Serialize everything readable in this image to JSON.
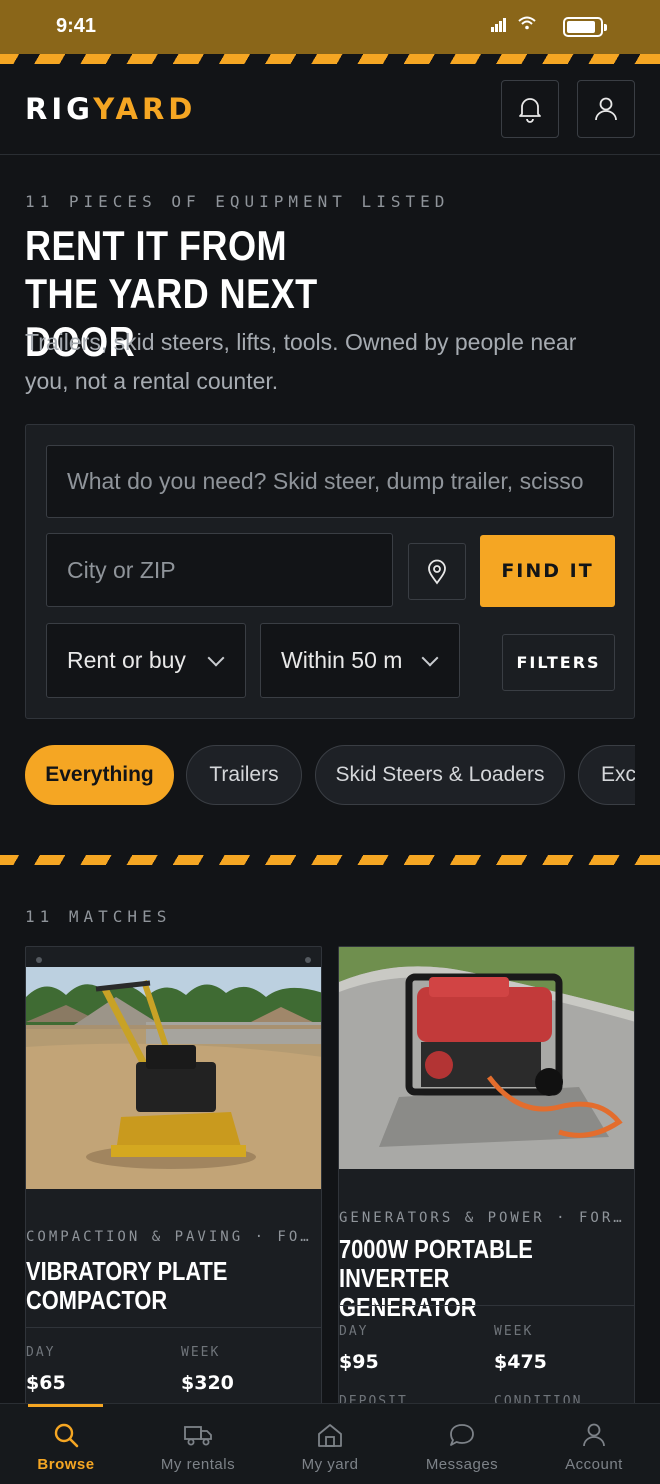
{
  "status": {
    "time": "9:41"
  },
  "brand": {
    "part1": "RIG",
    "part2": "YARD"
  },
  "header": {
    "notifications_icon": "bell-icon",
    "profile_icon": "user-icon"
  },
  "hero": {
    "kicker": "11 PIECES OF EQUIPMENT LISTED",
    "title": "RENT IT FROM THE YARD NEXT DOOR",
    "subtitle": "Trailers, skid steers, lifts, tools. Owned by people near you, not a rental counter."
  },
  "search": {
    "query_placeholder": "What do you need? Skid steer, dump trailer, scisso",
    "location_placeholder": "City or ZIP",
    "find_label": "FIND IT",
    "mode_value": "Rent or buy",
    "distance_value": "Within 50 m",
    "filters_label": "FILTERS"
  },
  "categories": [
    "Everything",
    "Trailers",
    "Skid Steers & Loaders",
    "Exc"
  ],
  "results": {
    "count_label": "11 MATCHES",
    "listings": [
      {
        "category": "COMPACTION & PAVING · FO…",
        "title": "VIBRATORY PLATE COMPACTOR",
        "day_label": "DAY",
        "day_price": "$65",
        "week_label": "WEEK",
        "week_price": "$320"
      },
      {
        "category": "GENERATORS & POWER · FOR…",
        "title": "7000W PORTABLE INVERTER GENERATOR",
        "day_label": "DAY",
        "day_price": "$95",
        "week_label": "WEEK",
        "week_price": "$475",
        "deposit_label": "DEPOSIT",
        "condition_label": "CONDITION"
      }
    ]
  },
  "tabs": [
    {
      "label": "Browse",
      "icon": "search-icon",
      "active": true
    },
    {
      "label": "My rentals",
      "icon": "truck-icon"
    },
    {
      "label": "My yard",
      "icon": "home-icon"
    },
    {
      "label": "Messages",
      "icon": "chat-icon"
    },
    {
      "label": "Account",
      "icon": "user-icon"
    }
  ],
  "colors": {
    "accent": "#f5a623",
    "background": "#121417",
    "panel": "#1b1e22",
    "statusbar": "#8a6619"
  }
}
